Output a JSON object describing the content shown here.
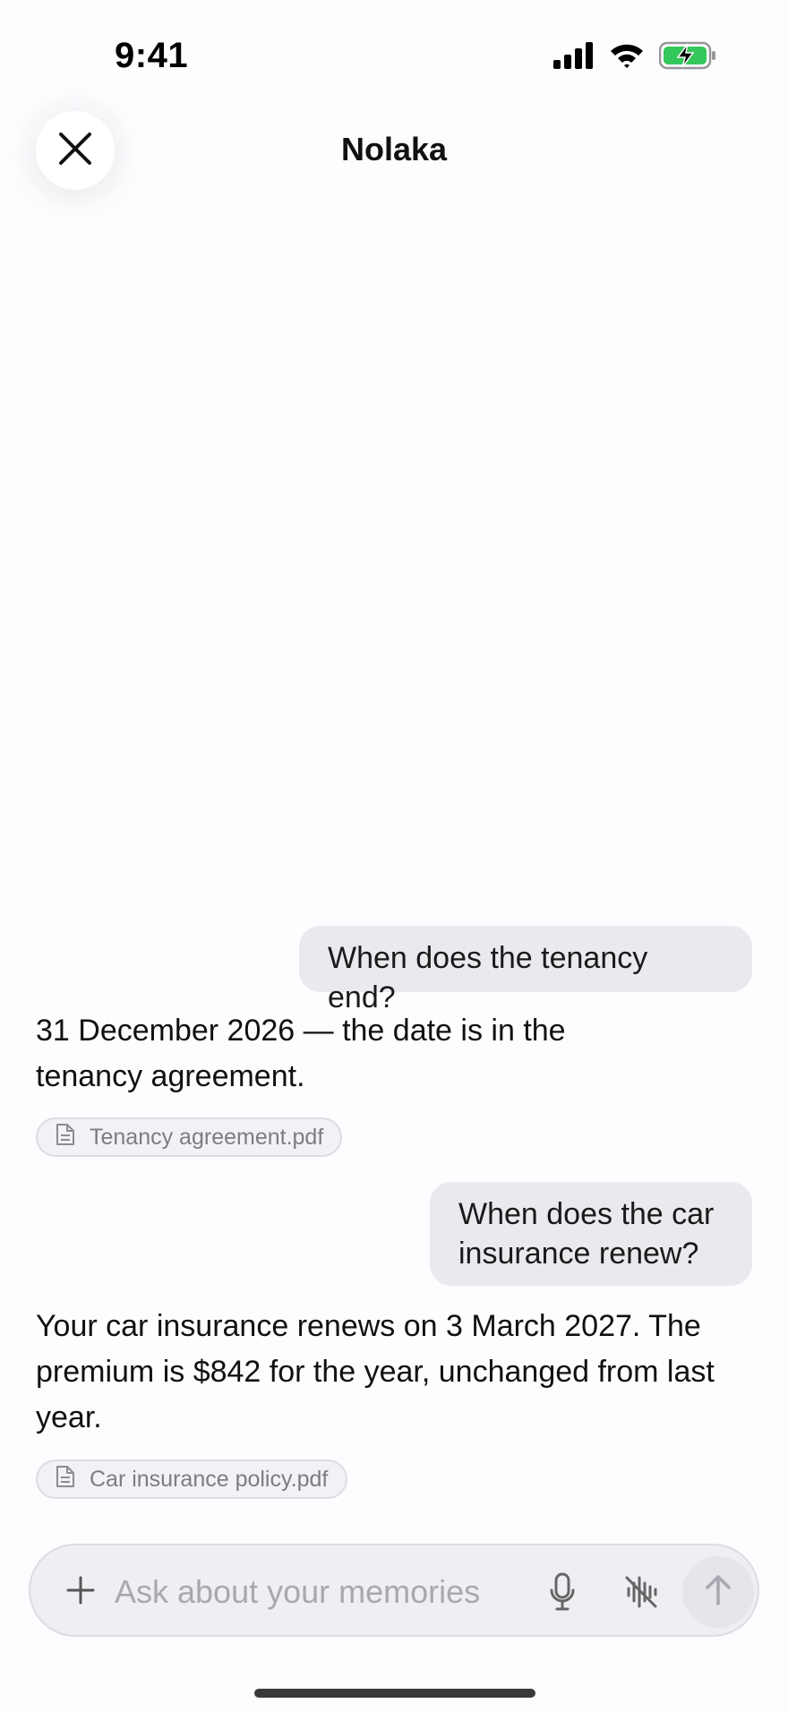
{
  "status_bar": {
    "time": "9:41",
    "icons": [
      "signal-bars-icon",
      "wifi-icon",
      "battery-charging-icon"
    ],
    "battery_color": "#34c759"
  },
  "header": {
    "title": "Nolaka",
    "close_icon": "close-icon"
  },
  "conversation": {
    "messages": [
      {
        "role": "user",
        "text": "When does the tenancy end?"
      },
      {
        "role": "assistant",
        "text": "31 December 2026 — the date is in the tenancy agreement.",
        "attachment": {
          "icon": "document-icon",
          "name": "Tenancy agreement.pdf"
        }
      },
      {
        "role": "user",
        "text": "When does the car insurance renew?"
      },
      {
        "role": "assistant",
        "text": "Your car insurance renews on 3 March 2027. The premium is $842 for the year, unchanged from last year.",
        "attachment": {
          "icon": "document-icon",
          "name": "Car insurance policy.pdf"
        }
      }
    ]
  },
  "composer": {
    "value": "",
    "placeholder": "Ask about your memories",
    "icons": [
      "plus-icon",
      "microphone-icon",
      "voice-mode-off-icon",
      "arrow-up-icon"
    ]
  },
  "colors": {
    "background": "#fdfcfe",
    "user_bubble": "#e9e9ee",
    "chip_background": "#f2f1f5",
    "placeholder": "#a9a7b0"
  }
}
